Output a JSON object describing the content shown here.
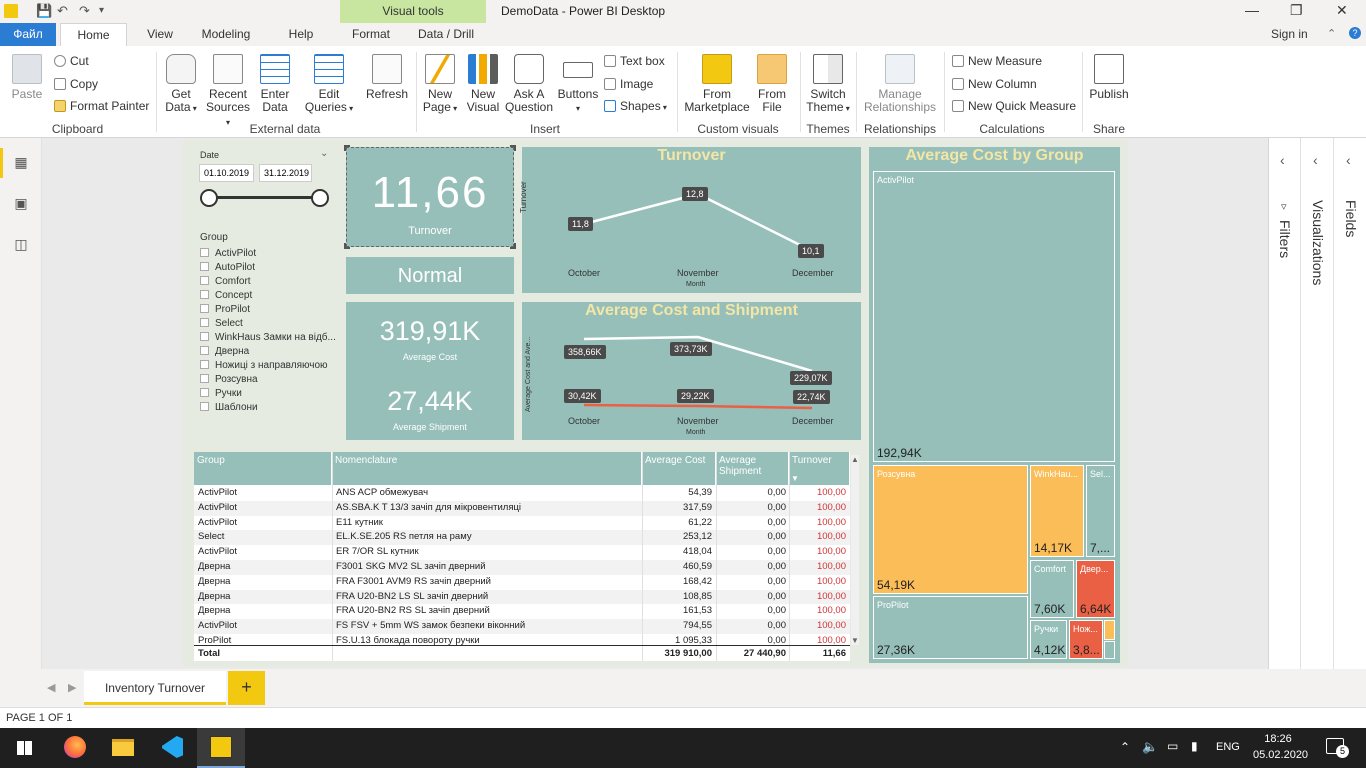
{
  "window": {
    "title": "DemoData - Power BI Desktop",
    "context_tab": "Visual tools"
  },
  "tabs": [
    {
      "label": "Файл"
    },
    {
      "label": "Home"
    },
    {
      "label": "View"
    },
    {
      "label": "Modeling"
    },
    {
      "label": "Help"
    },
    {
      "label": "Format"
    },
    {
      "label": "Data / Drill"
    }
  ],
  "signin": "Sign in",
  "ribbon": {
    "paste": "Paste",
    "cut": "Cut",
    "copy": "Copy",
    "format_painter": "Format Painter",
    "clipboard": "Clipboard",
    "get_data": "Get\nData",
    "get_data_l1": "Get",
    "get_data_l2": "Data",
    "recent_l1": "Recent",
    "recent_l2": "Sources",
    "enter_l1": "Enter",
    "enter_l2": "Data",
    "edit_l1": "Edit",
    "edit_l2": "Queries",
    "refresh": "Refresh",
    "external_data": "External data",
    "new_page_l1": "New",
    "new_page_l2": "Page",
    "new_visual_l1": "New",
    "new_visual_l2": "Visual",
    "ask_l1": "Ask A",
    "ask_l2": "Question",
    "buttons": "Buttons",
    "text_box": "Text box",
    "image": "Image",
    "shapes": "Shapes",
    "insert": "Insert",
    "from_market_l1": "From",
    "from_market_l2": "Marketplace",
    "from_file_l1": "From",
    "from_file_l2": "File",
    "custom_visuals": "Custom visuals",
    "switch_l1": "Switch",
    "switch_l2": "Theme",
    "themes": "Themes",
    "manage_l1": "Manage",
    "manage_l2": "Relationships",
    "relationships": "Relationships",
    "new_measure": "New Measure",
    "new_column": "New Column",
    "new_quick_measure": "New Quick Measure",
    "calculations": "Calculations",
    "publish": "Publish",
    "share": "Share"
  },
  "slicer": {
    "title": "Date",
    "from": "01.10.2019",
    "to": "31.12.2019",
    "group_title": "Group",
    "items": [
      "ActivPilot",
      "AutoPilot",
      "Comfort",
      "Concept",
      "ProPilot",
      "Select",
      "WinkHaus Замки на відб...",
      "Дверна",
      "Ножиці з направляючою",
      "Розсувна",
      "Ручки",
      "Шаблони"
    ]
  },
  "kpi": {
    "turnover_value": "11,66",
    "turnover_label": "Turnover",
    "status": "Normal",
    "avg_cost_value": "319,91K",
    "avg_cost_label": "Average Cost",
    "avg_ship_value": "27,44K",
    "avg_ship_label": "Average Shipment"
  },
  "turnover_chart": {
    "title": "Turnover",
    "ylabel": "Turnover",
    "xlabel": "Month",
    "categories": [
      "October",
      "November",
      "December"
    ],
    "values": [
      11.8,
      12.8,
      10.1
    ],
    "labels": [
      "11,8",
      "12,8",
      "10,1"
    ]
  },
  "cost_chart": {
    "title": "Average Cost and Shipment",
    "ylabel": "Average Cost and Ave...",
    "xlabel": "Month",
    "categories": [
      "October",
      "November",
      "December"
    ],
    "cost_labels": [
      "358,66K",
      "373,73K",
      "229,07K"
    ],
    "ship_labels": [
      "30,42K",
      "29,22K",
      "22,74K"
    ]
  },
  "treemap": {
    "title": "Average Cost by Group",
    "tiles": [
      {
        "name": "ActivPilot",
        "value": "192,94K"
      },
      {
        "name": "Розсувна",
        "value": "54,19K"
      },
      {
        "name": "WinkHau...",
        "value": "14,17K"
      },
      {
        "name": "Sel...",
        "value": "7,..."
      },
      {
        "name": "ProPilot",
        "value": "27,36K"
      },
      {
        "name": "Comfort",
        "value": "7,60K"
      },
      {
        "name": "Двер...",
        "value": "6,64K"
      },
      {
        "name": "Ручки",
        "value": "4,12K"
      },
      {
        "name": "Нож...",
        "value": "3,8..."
      }
    ]
  },
  "table": {
    "headers": [
      "Group",
      "Nomenclature",
      "Average Cost",
      "Average Shipment",
      "Turnover"
    ],
    "rows": [
      [
        "ActivPilot",
        "ANS ACP обмежувач",
        "54,39",
        "0,00",
        "100,00"
      ],
      [
        "ActivPilot",
        "AS.SBA.K T 13/3 зачіп для мікровентиляці",
        "317,59",
        "0,00",
        "100,00"
      ],
      [
        "ActivPilot",
        "E11 кутник",
        "61,22",
        "0,00",
        "100,00"
      ],
      [
        "Select",
        "EL.K.SE.205 RS петля на раму",
        "253,12",
        "0,00",
        "100,00"
      ],
      [
        "ActivPilot",
        "ER 7/OR SL кутник",
        "418,04",
        "0,00",
        "100,00"
      ],
      [
        "Дверна",
        "F3001 SKG MV2 SL зачіп дверний",
        "460,59",
        "0,00",
        "100,00"
      ],
      [
        "Дверна",
        "FRA F3001 AVM9 RS зачіп дверний",
        "168,42",
        "0,00",
        "100,00"
      ],
      [
        "Дверна",
        "FRA U20-BN2 LS SL зачіп дверний",
        "108,85",
        "0,00",
        "100,00"
      ],
      [
        "Дверна",
        "FRA U20-BN2 RS SL зачіп дверний",
        "161,53",
        "0,00",
        "100,00"
      ],
      [
        "ActivPilot",
        "FS FSV + 5mm WS замок безпеки віконний",
        "794,55",
        "0,00",
        "100,00"
      ],
      [
        "ProPilot",
        "FS.U.13 блокада повороту ручки",
        "1 095,33",
        "0,00",
        "100,00"
      ]
    ],
    "total": [
      "Total",
      "",
      "319 910,00",
      "27 440,90",
      "11,66"
    ]
  },
  "panes": {
    "filters": "Filters",
    "visualizations": "Visualizations",
    "fields": "Fields"
  },
  "pagetabs": {
    "active": "Inventory Turnover",
    "add": "+"
  },
  "status": "PAGE 1 OF 1",
  "tray": {
    "lang": "ENG",
    "time": "18:26",
    "date": "05.02.2020",
    "notif": "5"
  },
  "colors": {
    "tile": "#96bfb9",
    "orange": "#fbbd57",
    "red": "#ea6045",
    "title": "#f3e6a7"
  }
}
